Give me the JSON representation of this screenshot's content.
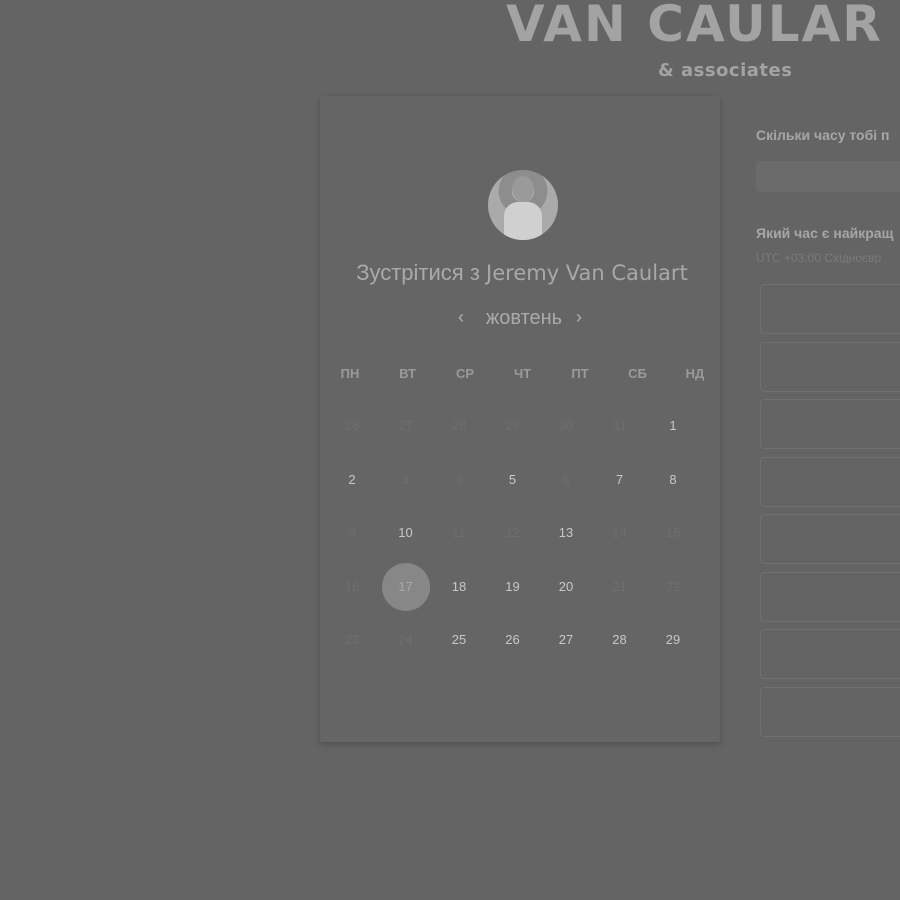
{
  "brand": {
    "name": "VAN CAULAR",
    "sub": "& associates"
  },
  "title": {
    "prefix": "Зустрітися з",
    "host": "Jeremy Van Caulart"
  },
  "calendar": {
    "month": "жовтень",
    "weekdays": [
      "ПН",
      "ВТ",
      "СР",
      "ЧТ",
      "ПТ",
      "СБ",
      "НД"
    ],
    "days": [
      [
        "26",
        "27",
        "28",
        "29",
        "30",
        "31",
        "1"
      ],
      [
        "2",
        "3",
        "4",
        "5",
        "6",
        "7",
        "8"
      ],
      [
        "9",
        "10",
        "11",
        "12",
        "13",
        "14",
        "15"
      ],
      [
        "16",
        "17",
        "18",
        "19",
        "20",
        "21",
        "22"
      ],
      [
        "23",
        "24",
        "25",
        "26",
        "27",
        "28",
        "29"
      ]
    ],
    "available": [
      [
        false,
        false,
        false,
        false,
        false,
        false,
        true
      ],
      [
        true,
        false,
        false,
        true,
        false,
        true,
        true
      ],
      [
        false,
        true,
        false,
        false,
        true,
        false,
        false
      ],
      [
        false,
        true,
        true,
        true,
        true,
        false,
        false
      ],
      [
        false,
        false,
        true,
        true,
        true,
        true,
        true
      ]
    ],
    "selected": "17"
  },
  "right": {
    "duration_question": "Скільки часу тобі п",
    "time_question": "Який час є найкращ",
    "timezone": "UTC +03:00 Східноєвр",
    "slots": [
      "",
      "",
      "",
      "",
      "",
      "",
      "",
      ""
    ]
  }
}
